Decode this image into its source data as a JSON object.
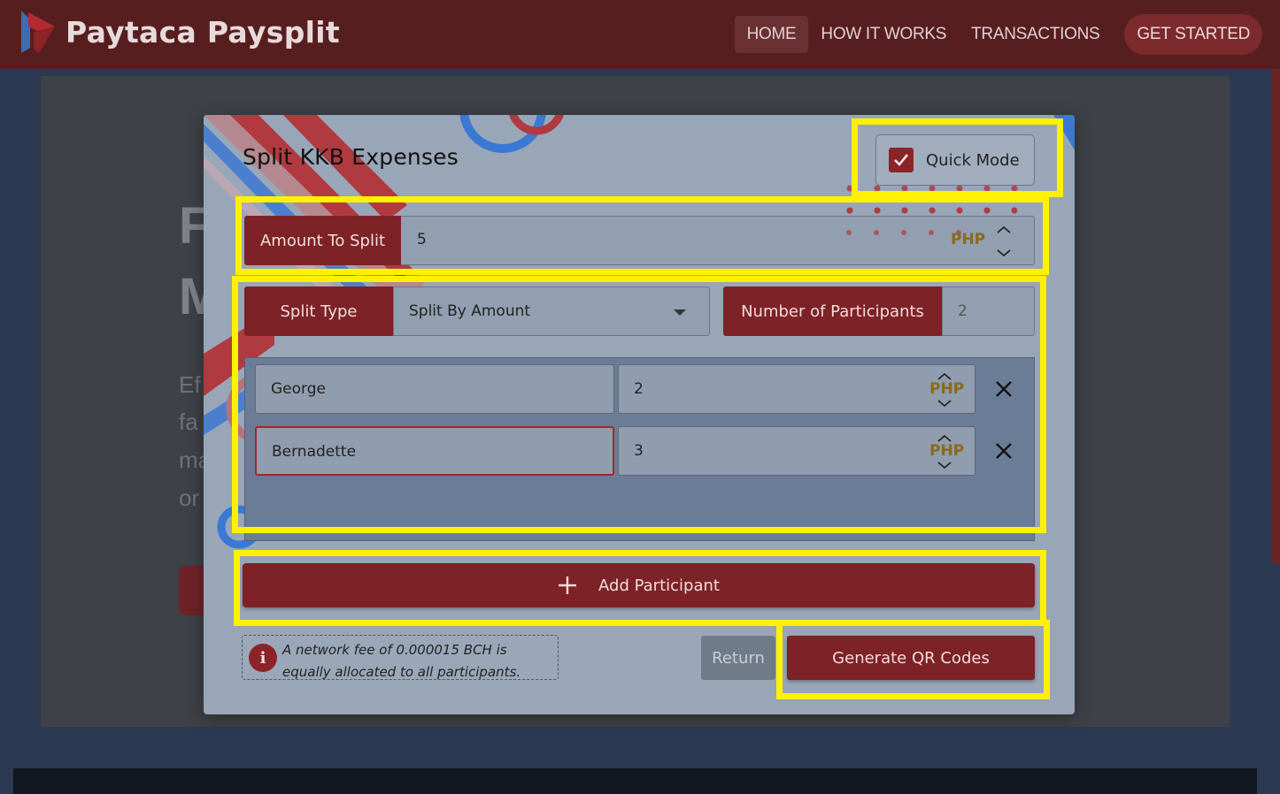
{
  "navbar": {
    "brand_name": "Paytaca Paysplit",
    "links": [
      {
        "label": "HOME",
        "active": true
      },
      {
        "label": "HOW IT WORKS",
        "active": false
      },
      {
        "label": "TRANSACTIONS",
        "active": false
      }
    ],
    "cta_label": "GET STARTED"
  },
  "background": {
    "hero_lines": [
      "F",
      "M"
    ],
    "text_lines": [
      "Ef",
      "fa",
      "ma",
      "or"
    ]
  },
  "modal": {
    "title": "Split KKB Expenses",
    "quick_mode": {
      "label": "Quick Mode",
      "checked": true
    },
    "amount": {
      "label": "Amount To Split",
      "value": "5",
      "currency": "PHP"
    },
    "split_type": {
      "label": "Split Type",
      "selected": "Split By Amount"
    },
    "participant_count": {
      "label": "Number of Participants",
      "value": "2"
    },
    "participants": [
      {
        "name": "George",
        "amount": "2",
        "currency": "PHP"
      },
      {
        "name": "Bernadette",
        "amount": "3",
        "currency": "PHP"
      }
    ],
    "add_participant_label": "Add Participant",
    "fee_note": "A network fee of 0.000015 BCH is equally allocated to all participants.",
    "fee_icon_glyph": "i",
    "return_label": "Return",
    "generate_label": "Generate QR Codes"
  },
  "colors": {
    "brand_red": "#7d2226",
    "navbar_bg": "#571e20",
    "modal_bg": "#99a6b8",
    "highlight": "#fff200"
  },
  "icons": {
    "logo": "paytaca-logo-icon",
    "check": "checkmark-icon",
    "spinner": "chevron-up-down-icon",
    "dropdown": "caret-down-icon",
    "remove": "close-icon",
    "add": "plus-icon",
    "info": "info-icon"
  }
}
